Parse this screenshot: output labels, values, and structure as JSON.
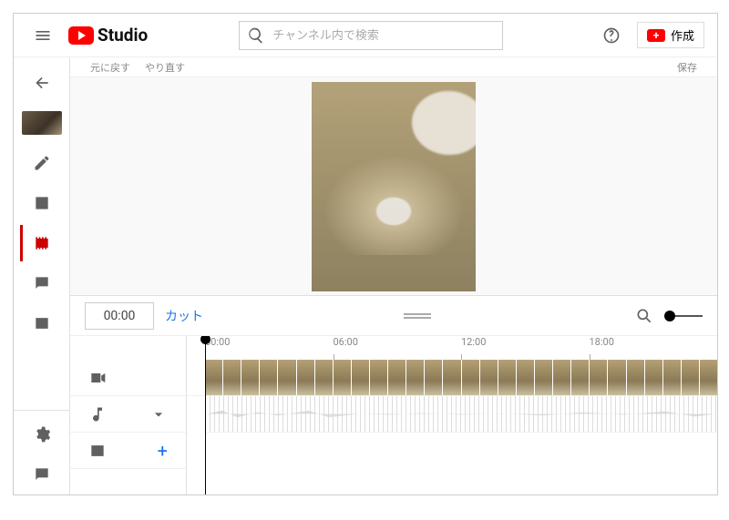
{
  "header": {
    "brand": "Studio",
    "search_placeholder": "チャンネル内で検索",
    "create_label": "作成"
  },
  "crumbs": {
    "left_a": "元に戻す",
    "left_b": "やり直す",
    "right": "保存"
  },
  "tool": {
    "current_time": "00:00",
    "cut_label": "カット"
  },
  "ruler": [
    "00:00",
    "06:00",
    "12:00",
    "18:00"
  ],
  "tracks": {
    "video_label": "video",
    "audio_label": "audio",
    "endscreen_label": "endscreen"
  }
}
